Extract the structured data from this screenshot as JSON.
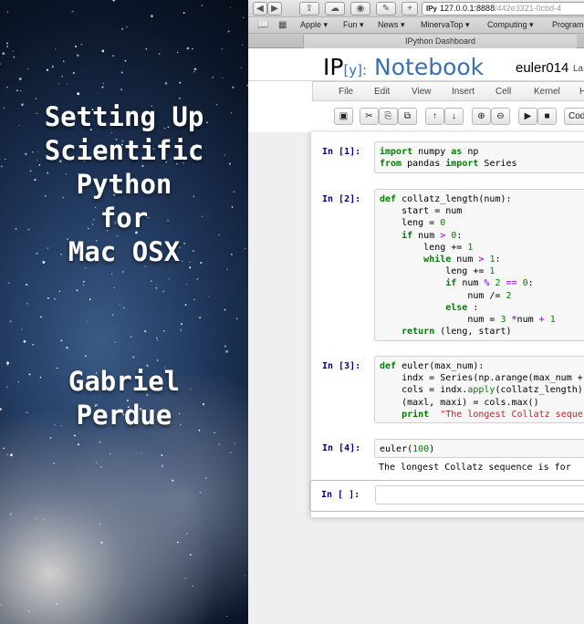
{
  "cover": {
    "title_lines": [
      "Setting Up",
      "Scientific",
      "Python",
      "for",
      "Mac OSX"
    ],
    "author_lines": [
      "Gabriel",
      "Perdue"
    ]
  },
  "browser": {
    "url_badge": "IPy",
    "url_host": "127.0.0.1:8888",
    "url_path": "/442e3321-0cbd-4",
    "bookmarks": [
      "Apple ▾",
      "Fun ▾",
      "News ▾",
      "MinervaTop ▾",
      "Computing ▾",
      "Program"
    ],
    "tab_title": "IPython Dashboard"
  },
  "notebook": {
    "logo_prefix": "IP",
    "logo_bracket": "[y]:",
    "logo_word": "Notebook",
    "name": "euler014",
    "status": "La",
    "menus": [
      "File",
      "Edit",
      "View",
      "Insert",
      "Cell",
      "Kernel",
      "H"
    ],
    "celltype": "Cod"
  },
  "cells": [
    {
      "prompt": "In [1]:",
      "lines": [
        [
          [
            "kw",
            "import"
          ],
          [
            "",
            "numpy "
          ],
          [
            "kw",
            "as"
          ],
          [
            "",
            "np"
          ]
        ],
        [
          [
            "kw",
            "from"
          ],
          [
            "",
            "pandas "
          ],
          [
            "kw",
            "import"
          ],
          [
            "",
            "Series"
          ]
        ]
      ]
    },
    {
      "prompt": "In [2]:",
      "lines": [
        [
          [
            "kw",
            "def "
          ],
          [
            "",
            "collatz_length(num):"
          ]
        ],
        [
          [
            "",
            "    start = num"
          ]
        ],
        [
          [
            "",
            "    leng = "
          ],
          [
            "num",
            "0"
          ]
        ],
        [
          [
            "",
            "    "
          ],
          [
            "kw",
            "if"
          ],
          [
            "",
            "num "
          ],
          [
            "op",
            ">"
          ],
          [
            "",
            ""
          ],
          [
            "num",
            "0"
          ],
          [
            "",
            ":"
          ]
        ],
        [
          [
            "",
            "        leng += "
          ],
          [
            "num",
            "1"
          ]
        ],
        [
          [
            "",
            "        "
          ],
          [
            "kw",
            "while"
          ],
          [
            "",
            "num "
          ],
          [
            "op",
            ">"
          ],
          [
            "",
            ""
          ],
          [
            "num",
            "1"
          ],
          [
            "",
            ":"
          ]
        ],
        [
          [
            "",
            "            leng += "
          ],
          [
            "num",
            "1"
          ]
        ],
        [
          [
            "",
            "            "
          ],
          [
            "kw",
            "if"
          ],
          [
            "",
            "num "
          ],
          [
            "op",
            "%"
          ],
          [
            "",
            ""
          ],
          [
            "num",
            "2"
          ],
          [
            "",
            ""
          ],
          [
            "op",
            "=="
          ],
          [
            "",
            ""
          ],
          [
            "num",
            "0"
          ],
          [
            "",
            ":"
          ]
        ],
        [
          [
            "",
            "                num /= "
          ],
          [
            "num",
            "2"
          ]
        ],
        [
          [
            "",
            "            "
          ],
          [
            "kw",
            "else"
          ],
          [
            "",
            ":"
          ]
        ],
        [
          [
            "",
            "                num = "
          ],
          [
            "num",
            "3"
          ],
          [
            "",
            ""
          ],
          [
            "op",
            "*"
          ],
          [
            "",
            "num "
          ],
          [
            "op",
            "+"
          ],
          [
            "",
            ""
          ],
          [
            "num",
            "1"
          ]
        ],
        [
          [
            "",
            "    "
          ],
          [
            "kw",
            "return"
          ],
          [
            "",
            "(leng, start)"
          ]
        ]
      ]
    },
    {
      "prompt": "In [3]:",
      "lines": [
        [
          [
            "kw",
            "def "
          ],
          [
            "",
            "euler(max_num):"
          ]
        ],
        [
          [
            "",
            "    indx = Series(np.arange(max_num +"
          ]
        ],
        [
          [
            "",
            "    cols = indx."
          ],
          [
            "num",
            "apply"
          ],
          [
            "",
            "(collatz_length)"
          ]
        ],
        [
          [
            "",
            "    (maxl, maxi) = cols.max()"
          ]
        ],
        [
          [
            "",
            "    "
          ],
          [
            "kw",
            "print"
          ],
          [
            "",
            ""
          ],
          [
            "str",
            "\"The longest Collatz seque"
          ]
        ]
      ]
    },
    {
      "prompt": "In [4]:",
      "lines": [
        [
          [
            "",
            "euler("
          ],
          [
            "num",
            "100"
          ],
          [
            "",
            ")"
          ]
        ]
      ],
      "output": "The longest Collatz sequence is for"
    },
    {
      "prompt": "In [ ]:",
      "lines": [
        [
          [
            "",
            ""
          ]
        ]
      ]
    }
  ]
}
